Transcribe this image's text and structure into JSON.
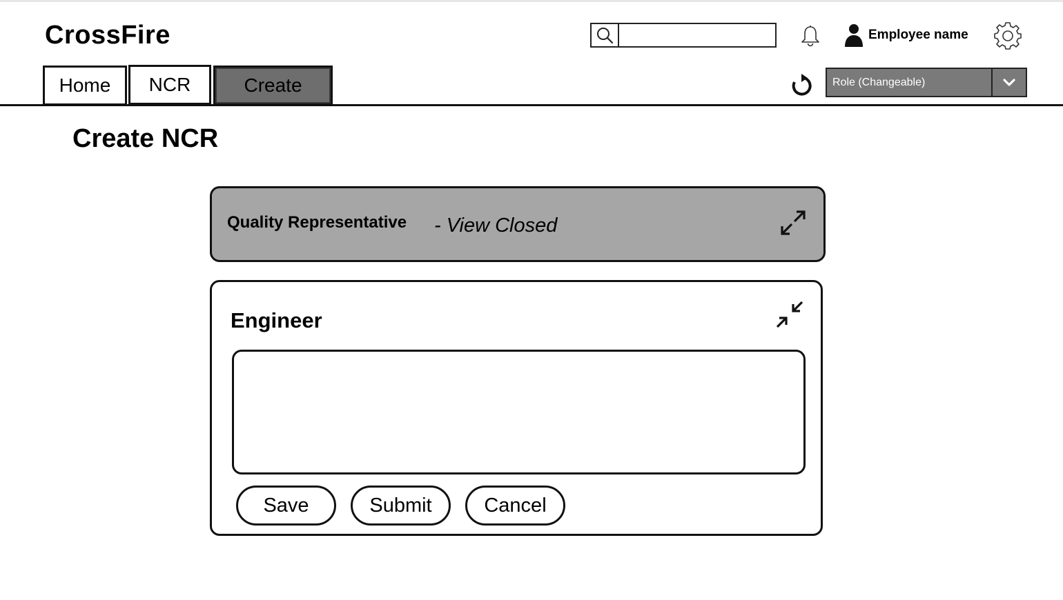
{
  "app": {
    "title": "CrossFire"
  },
  "header": {
    "search": {
      "placeholder": "",
      "value": ""
    },
    "user": {
      "name": "Employee name"
    }
  },
  "nav": {
    "tabs": [
      {
        "label": "Home",
        "active": false
      },
      {
        "label": "NCR",
        "active": false
      },
      {
        "label": "Create",
        "active": true
      }
    ]
  },
  "role_select": {
    "value": "Role (Changeable)"
  },
  "page": {
    "title": "Create NCR"
  },
  "sections": {
    "quality": {
      "title": "Quality Representative",
      "status": "- View Closed",
      "state": "collapsed"
    },
    "engineer": {
      "title": "Engineer",
      "state": "expanded",
      "text_value": ""
    }
  },
  "actions": {
    "save": "Save",
    "submit": "Submit",
    "cancel": "Cancel"
  },
  "colors": {
    "active_tab": "#6e6e6e",
    "closed_panel": "#a6a6a6",
    "role_select_bg": "#7a7a7a"
  },
  "icons": [
    "search-icon",
    "bell-icon",
    "user-icon",
    "gear-icon",
    "refresh-icon",
    "chevron-down-icon",
    "expand-icon",
    "collapse-icon"
  ]
}
